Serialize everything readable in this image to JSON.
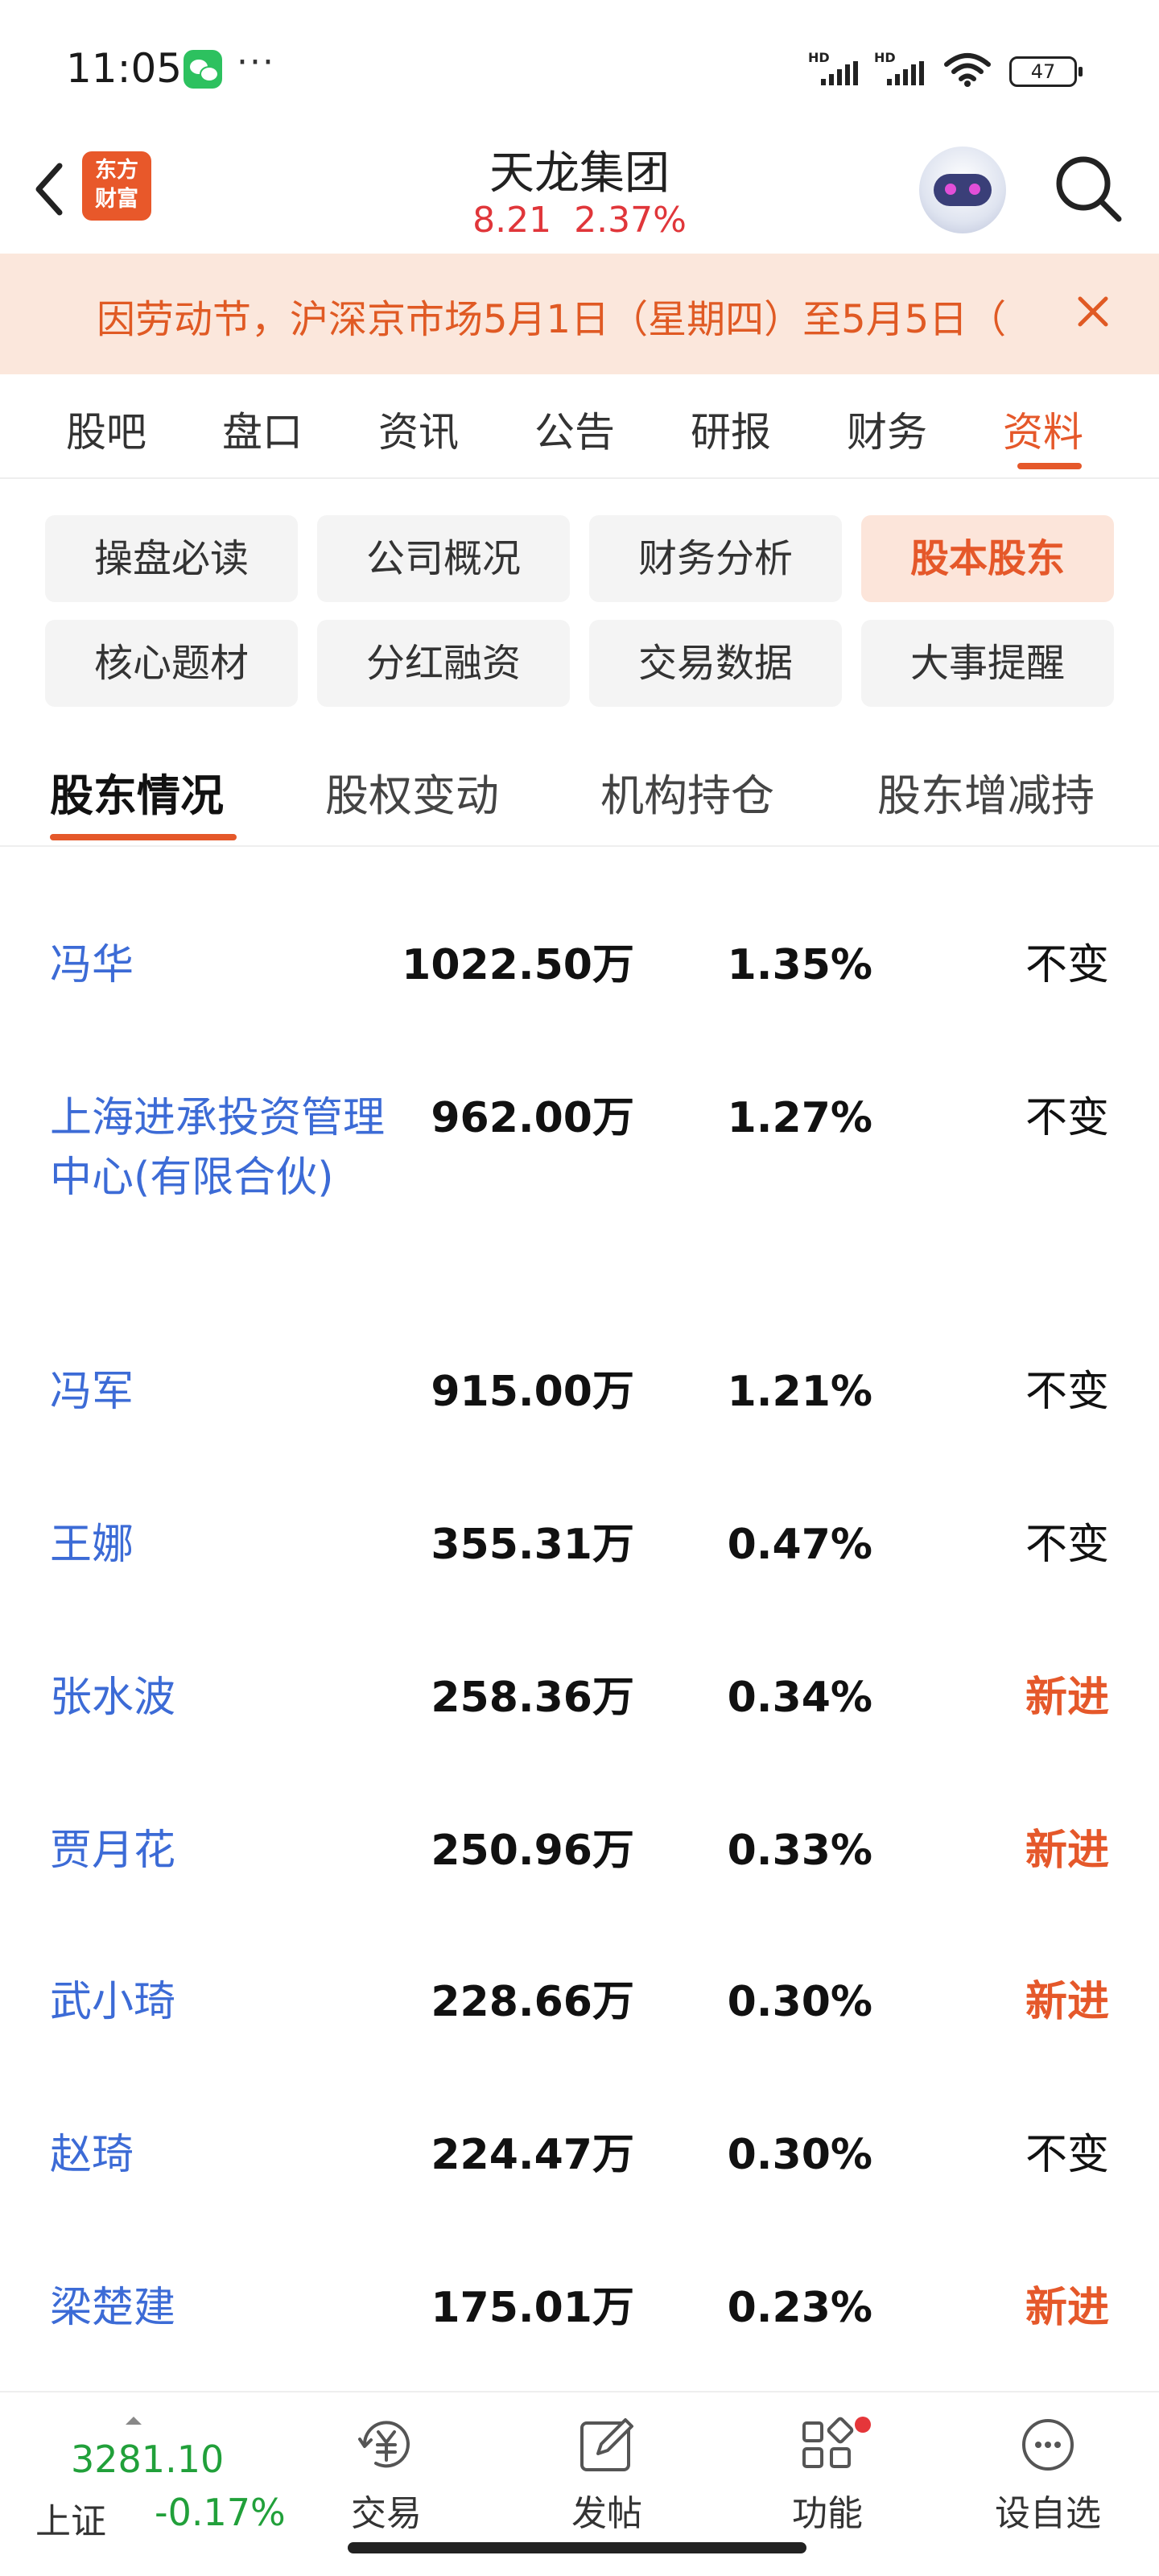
{
  "status_bar": {
    "time": "11:05",
    "dots": "···",
    "hd_1": "HD",
    "hd_2": "HD",
    "battery": "47"
  },
  "header": {
    "logo_line1": "东方",
    "logo_line2": "财富",
    "stock_name": "天龙集团",
    "price": "8.21",
    "change_pct": "2.37%"
  },
  "banner": {
    "text": "因劳动节，沪深京市场5月1日（星期四）至5月5日（"
  },
  "main_tabs": [
    {
      "label": "股吧"
    },
    {
      "label": "盘口"
    },
    {
      "label": "资讯"
    },
    {
      "label": "公告"
    },
    {
      "label": "研报"
    },
    {
      "label": "财务"
    },
    {
      "label": "资料"
    }
  ],
  "chips": [
    {
      "label": "操盘必读"
    },
    {
      "label": "公司概况"
    },
    {
      "label": "财务分析"
    },
    {
      "label": "股本股东"
    },
    {
      "label": "核心题材"
    },
    {
      "label": "分红融资"
    },
    {
      "label": "交易数据"
    },
    {
      "label": "大事提醒"
    }
  ],
  "sub_tabs": [
    {
      "label": "股东情况"
    },
    {
      "label": "股权变动"
    },
    {
      "label": "机构持仓"
    },
    {
      "label": "股东增减持"
    }
  ],
  "holders": [
    {
      "name": "冯华",
      "shares": "1022.50万",
      "pct": "1.35%",
      "change": "不变"
    },
    {
      "name": "上海进承投资管理中心(有限合伙)",
      "shares": "962.00万",
      "pct": "1.27%",
      "change": "不变"
    },
    {
      "name": "冯军",
      "shares": "915.00万",
      "pct": "1.21%",
      "change": "不变"
    },
    {
      "name": "王娜",
      "shares": "355.31万",
      "pct": "0.47%",
      "change": "不变"
    },
    {
      "name": "张水波",
      "shares": "258.36万",
      "pct": "0.34%",
      "change": "新进"
    },
    {
      "name": "贾月花",
      "shares": "250.96万",
      "pct": "0.33%",
      "change": "新进"
    },
    {
      "name": "武小琦",
      "shares": "228.66万",
      "pct": "0.30%",
      "change": "新进"
    },
    {
      "name": "赵琦",
      "shares": "224.47万",
      "pct": "0.30%",
      "change": "不变"
    },
    {
      "name": "梁楚建",
      "shares": "175.01万",
      "pct": "0.23%",
      "change": "新进"
    }
  ],
  "bottom_nav": {
    "index_value": "3281.10",
    "index_name": "上证",
    "index_change": "-0.17%",
    "items": [
      {
        "label": "交易",
        "icon": "trade-icon"
      },
      {
        "label": "发帖",
        "icon": "post-icon"
      },
      {
        "label": "功能",
        "icon": "functions-icon"
      },
      {
        "label": "设自选",
        "icon": "watchlist-icon"
      }
    ]
  },
  "colors": {
    "accent": "#e5582a",
    "link_blue": "#3c6bd6",
    "price_red": "#e0363a",
    "index_green": "#21a03a",
    "banner_bg": "#fbe7dc"
  }
}
